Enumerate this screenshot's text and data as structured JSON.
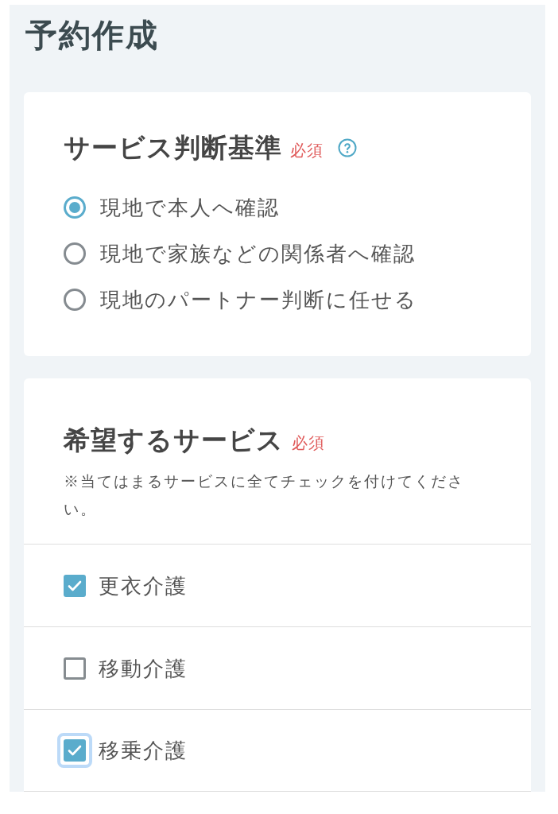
{
  "page": {
    "title": "予約作成"
  },
  "judgement": {
    "title": "サービス判断基準",
    "required": "必須",
    "options": [
      {
        "label": "現地で本人へ確認",
        "selected": true
      },
      {
        "label": "現地で家族などの関係者へ確認",
        "selected": false
      },
      {
        "label": "現地のパートナー判断に任せる",
        "selected": false
      }
    ]
  },
  "services": {
    "title": "希望するサービス",
    "required": "必須",
    "note": "※当てはまるサービスに全てチェックを付けてください。",
    "items": [
      {
        "label": "更衣介護",
        "checked": true,
        "focused": false
      },
      {
        "label": "移動介護",
        "checked": false,
        "focused": false
      },
      {
        "label": "移乗介護",
        "checked": true,
        "focused": true
      }
    ]
  }
}
